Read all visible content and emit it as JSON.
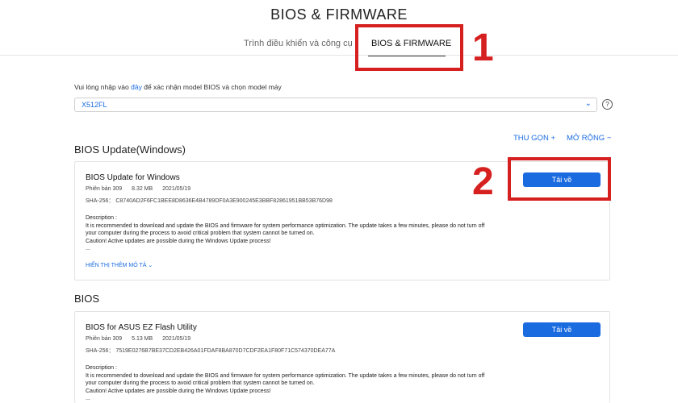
{
  "header": {
    "title": "BIOS & FIRMWARE",
    "tabs": [
      {
        "label": "Trình điều khiển và công cụ"
      },
      {
        "label": "BIOS & FIRMWARE"
      }
    ]
  },
  "annotations": {
    "num1": "1",
    "num2": "2"
  },
  "model": {
    "instruction_pre": "Vui lòng nhập vào",
    "instruction_link": "đây",
    "instruction_post": "để xác nhận model BIOS và chọn model máy",
    "selected": "X512FL",
    "help": "?",
    "chevron": "⌄"
  },
  "controls": {
    "collapse": "THU GỌN +",
    "expand": "MỞ RỘNG −"
  },
  "sections": [
    {
      "title": "BIOS Update(Windows)",
      "card": {
        "title": "BIOS Update for Windows",
        "version": "Phiên bản 309",
        "size": "8.32 MB",
        "date": "2021/05/19",
        "sha": "SHA-256： C8740AD2F6FC1BEE8D8636E4B4789DF0A3E900245E3BBF82861951BB53B76D98",
        "desc_label": "Description :",
        "desc_lines": [
          "It is recommended to download and update the BIOS and firmware for system performance optimization. The update takes a few minutes, please do not turn off",
          "your computer during the process to avoid critical problem that system cannot be turned on.",
          "Caution! Active updates are possible during the Windows Update process!",
          "..."
        ],
        "show_more": "HIỂN THỊ THÊM MÔ TẢ ⌄",
        "download": "Tải về"
      }
    },
    {
      "title": "BIOS",
      "card": {
        "title": "BIOS for ASUS EZ Flash Utility",
        "version": "Phiên bản 309",
        "size": "5.13 MB",
        "date": "2021/05/19",
        "sha": "SHA-256： 7519E0276B7BE37CD2EB426A01FDAF8BA870D7CDF2EA1F80F71C574370DEA77A",
        "desc_label": "Description :",
        "desc_lines": [
          "It is recommended to download and update the BIOS and firmware for system performance optimization. The update takes a few minutes, please do not turn off",
          "your computer during the process to avoid critical problem that system cannot be turned on.",
          "Caution! Active updates are possible during the Windows Update process!",
          "..."
        ],
        "download": "Tải về"
      }
    }
  ],
  "colors": {
    "accent": "#1a6be0",
    "annotation": "#d61f1f"
  }
}
